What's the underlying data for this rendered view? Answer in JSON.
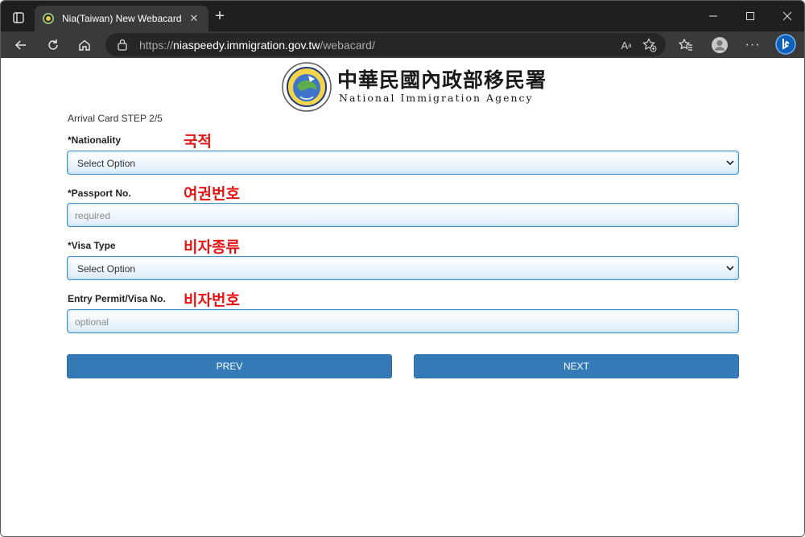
{
  "browser": {
    "tab_title": "Nia(Taiwan) New Webacard",
    "url_scheme": "https://",
    "url_host": "niaspeedy.immigration.gov.tw",
    "url_path": "/webacard/",
    "icons": [
      "sidebar-icon",
      "close-icon",
      "plus-icon",
      "minimize-icon",
      "maximize-icon",
      "close-window-icon",
      "back-icon",
      "refresh-icon",
      "home-icon",
      "lock-icon",
      "read-aloud-icon",
      "add-favorite-icon",
      "favorites-icon",
      "profile-icon",
      "more-icon",
      "bing-copilot-icon"
    ],
    "colors": {
      "tabstrip": "#1f1f1f",
      "toolbar": "#3a3a3a",
      "address_bar": "#262626"
    }
  },
  "header": {
    "org_name_zh": "中華民國內政部移民署",
    "org_name_en": "National Immigration Agency"
  },
  "form": {
    "step": "Arrival Card STEP 2/5",
    "fields": [
      {
        "label": "*Nationality",
        "annotation": "국적",
        "type": "select",
        "value": "Select Option"
      },
      {
        "label": "*Passport No.",
        "annotation": "여권번호",
        "type": "text",
        "placeholder": "required"
      },
      {
        "label": "*Visa Type",
        "annotation": "비자종류",
        "type": "select",
        "value": "Select Option"
      },
      {
        "label": "Entry Permit/Visa No.",
        "annotation": "비자번호",
        "type": "text",
        "placeholder": "optional"
      }
    ],
    "prev_label": "PREV",
    "next_label": "NEXT",
    "colors": {
      "button": "#337ab7",
      "field_border": "#3b8fd0",
      "annotation": "#e41414"
    }
  }
}
